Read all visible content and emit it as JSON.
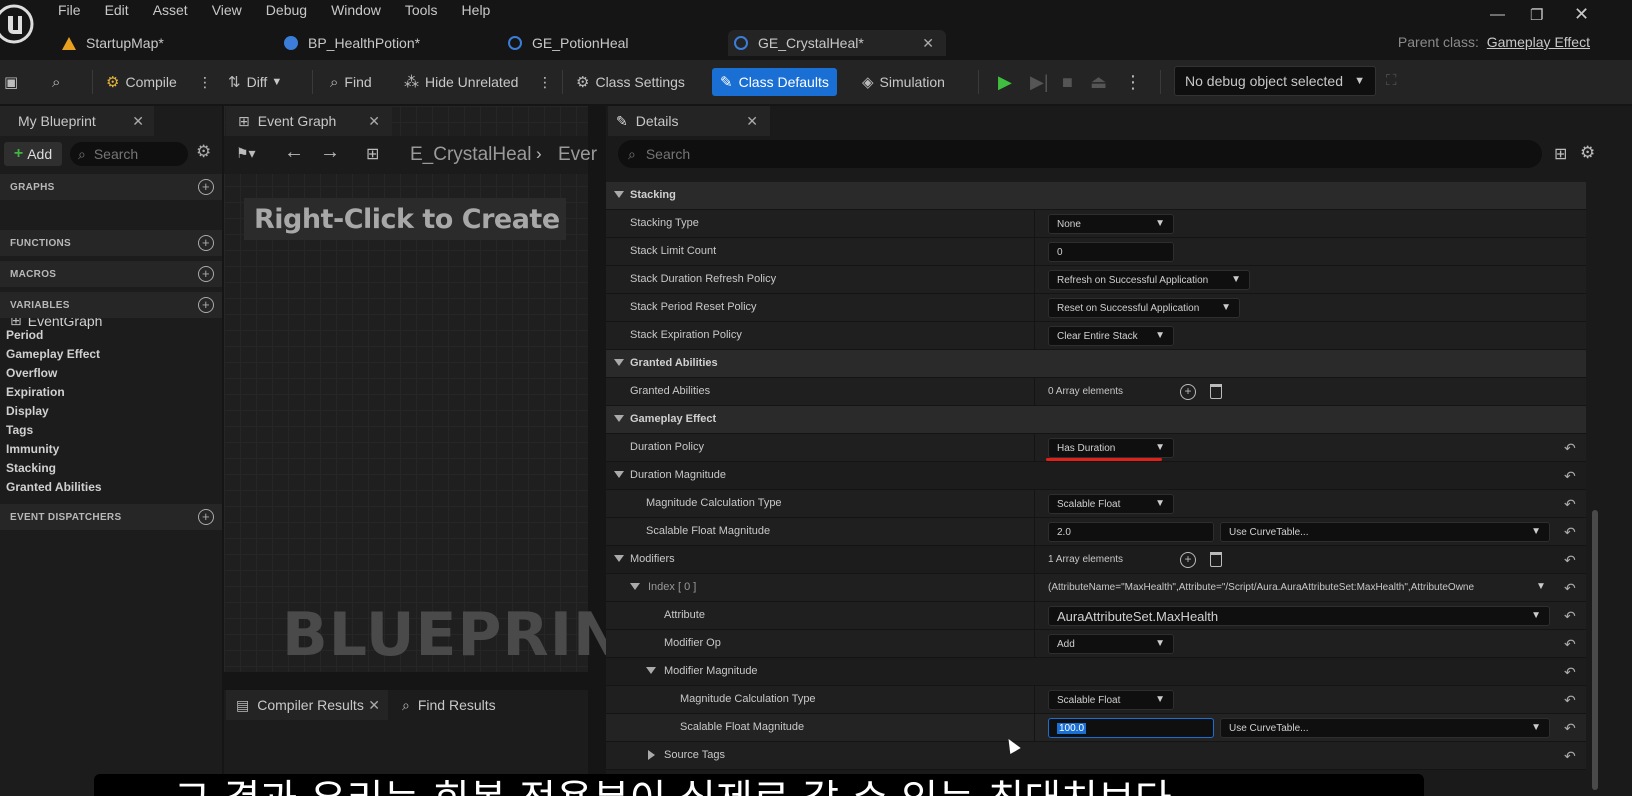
{
  "menu": [
    "File",
    "Edit",
    "Asset",
    "View",
    "Debug",
    "Window",
    "Tools",
    "Help"
  ],
  "tabs": [
    {
      "label": "StartupMap*",
      "color": "#e8a020"
    },
    {
      "label": "BP_HealthPotion*",
      "color": "#3b7dd8"
    },
    {
      "label": "GE_PotionHeal",
      "color": "#3b7dd8"
    },
    {
      "label": "GE_CrystalHeal*",
      "color": "#3b7dd8"
    }
  ],
  "parent_class": {
    "prefix": "Parent class:",
    "value": "Gameplay Effect"
  },
  "toolbar": {
    "compile": "Compile",
    "diff": "Diff",
    "find": "Find",
    "hide_unrelated": "Hide Unrelated",
    "class_settings": "Class Settings",
    "class_defaults": "Class Defaults",
    "simulation": "Simulation",
    "debug_object": "No debug object selected"
  },
  "left_panel": {
    "tab": "My Blueprint",
    "add": "Add",
    "search_placeholder": "Search",
    "sections": {
      "graphs": "GRAPHS",
      "functions": "FUNCTIONS",
      "macros": "MACROS",
      "variables": "VARIABLES",
      "event_dispatchers": "EVENT DISPATCHERS"
    },
    "graph_item": "EventGraph",
    "variables": [
      "Period",
      "Gameplay Effect",
      "Overflow",
      "Expiration",
      "Display",
      "Tags",
      "Immunity",
      "Stacking",
      "Granted Abilities"
    ]
  },
  "graph_panel": {
    "tab": "Event Graph",
    "breadcrumb_a": "E_CrystalHeal",
    "breadcrumb_b": "Ever",
    "hint": "Right-Click to Create No",
    "watermark": "BLUEPRINT",
    "compiler_tab": "Compiler Results",
    "find_tab": "Find Results"
  },
  "details": {
    "tab": "Details",
    "search_placeholder": "Search",
    "stacking": {
      "title": "Stacking",
      "stacking_type": {
        "label": "Stacking Type",
        "value": "None"
      },
      "stack_limit": {
        "label": "Stack Limit Count",
        "value": "0"
      },
      "duration_refresh": {
        "label": "Stack Duration Refresh Policy",
        "value": "Refresh on Successful Application"
      },
      "period_reset": {
        "label": "Stack Period Reset Policy",
        "value": "Reset on Successful Application"
      },
      "expiration": {
        "label": "Stack Expiration Policy",
        "value": "Clear Entire Stack"
      }
    },
    "granted_abilities": {
      "title": "Granted Abilities",
      "label": "Granted Abilities",
      "value": "0 Array elements"
    },
    "gameplay_effect": {
      "title": "Gameplay Effect",
      "duration_policy": {
        "label": "Duration Policy",
        "value": "Has Duration"
      },
      "duration_magnitude": "Duration Magnitude",
      "calc_type": {
        "label": "Magnitude Calculation Type",
        "value": "Scalable Float"
      },
      "scalable": {
        "label": "Scalable Float Magnitude",
        "value": "2.0",
        "curve": "Use CurveTable..."
      }
    },
    "modifiers": {
      "label": "Modifiers",
      "value": "1 Array elements",
      "index_label": "Index [ 0 ]",
      "index_value": "(AttributeName=\"MaxHealth\",Attribute=\"/Script/Aura.AuraAttributeSet:MaxHealth\",AttributeOwne",
      "attribute": {
        "label": "Attribute",
        "value": "AuraAttributeSet.MaxHealth"
      },
      "modifier_op": {
        "label": "Modifier Op",
        "value": "Add"
      },
      "modifier_magnitude": "Modifier Magnitude",
      "calc_type": {
        "label": "Magnitude Calculation Type",
        "value": "Scalable Float"
      },
      "scalable": {
        "label": "Scalable Float Magnitude",
        "value": "100.0",
        "curve": "Use CurveTable..."
      },
      "source_tags": "Source Tags"
    }
  },
  "subtitle": "그 결과 우리는 회복 적용분이 실제로 갈 수 있는 최대치보다"
}
